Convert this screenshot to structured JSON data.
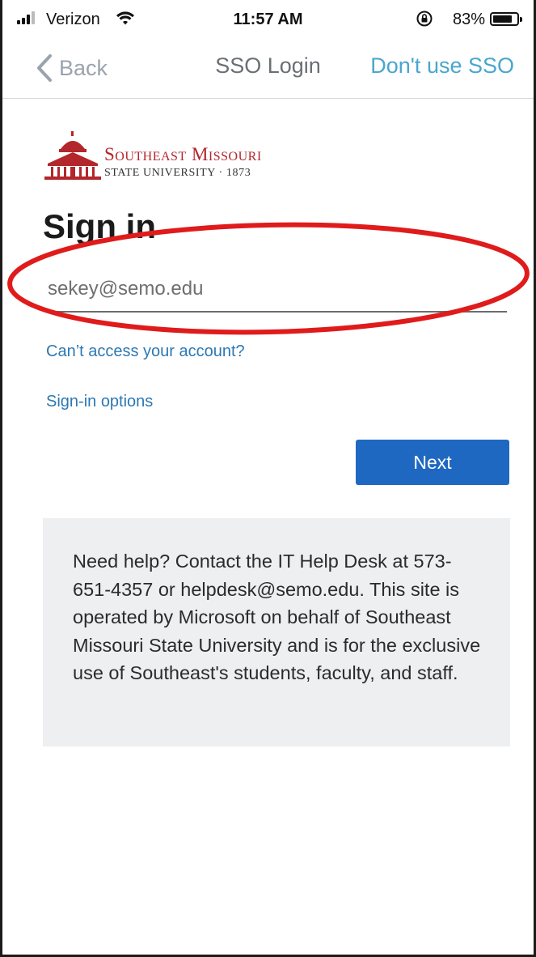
{
  "status_bar": {
    "carrier": "Verizon",
    "time": "11:57 AM",
    "battery_percent": "83%",
    "battery_level": 0.83
  },
  "nav": {
    "back_label": "Back",
    "title": "SSO Login",
    "right_action": "Don't use SSO"
  },
  "logo": {
    "line1": "Southeast Missouri",
    "line2": "STATE UNIVERSITY · 1873"
  },
  "sign_in": {
    "title": "Sign in",
    "email_value": "sekey@semo.edu",
    "cant_access_link": "Can’t access your account?",
    "sign_in_options_link": "Sign-in options",
    "next_button": "Next"
  },
  "help": {
    "text": "Need help? Contact the IT Help Desk at 573-651-4357 or helpdesk@semo.edu. This site is operated by Microsoft on behalf of Southeast Missouri State University and is for the exclusive use of Southeast's students, faculty, and staff."
  },
  "colors": {
    "accent_blue": "#1f68c1",
    "link_blue": "#2c78b3",
    "nav_action_blue": "#4aa6cf",
    "brand_red": "#b3262b",
    "annotation_red": "#e01b1b"
  }
}
